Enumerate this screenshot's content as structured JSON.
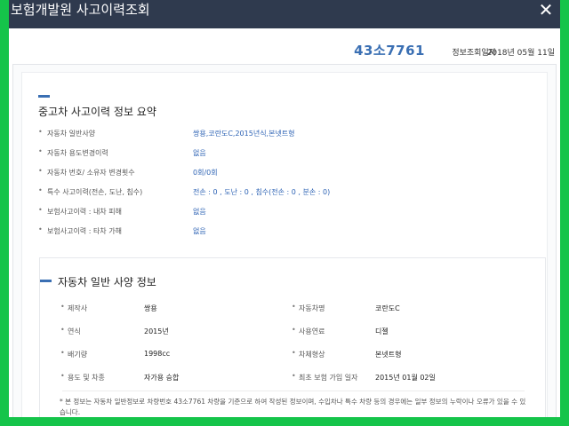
{
  "window": {
    "title": "보험개발원 사고이력조회",
    "close_icon": "close-icon"
  },
  "header": {
    "plate_number": "43소7761",
    "inquiry_label": "정보조회일자",
    "inquiry_date": "2018년 05월 11일"
  },
  "summary": {
    "title": "중고차 사고이력 정보 요약",
    "rows": [
      {
        "label": "자동차 일반사양",
        "value": "쌍용,코란도C,2015년식,본넷트형"
      },
      {
        "label": "자동차 용도변경이력",
        "value": "없음"
      },
      {
        "label": "자동차 번호/ 소유자 변경횟수",
        "value": "0회/0회"
      },
      {
        "label": "특수 사고이력(전손, 도난, 침수)",
        "value": "전손 : 0 , 도난 : 0 , 침수(전손 : 0 , 분손 : 0)"
      },
      {
        "label": "보험사고이력 : 내차 피해",
        "value": "없음"
      },
      {
        "label": "보험사고이력 : 타차 가해",
        "value": "없음"
      }
    ]
  },
  "specs": {
    "title": "자동차 일반 사양 정보",
    "left": [
      {
        "label": "제작사",
        "value": "쌍용"
      },
      {
        "label": "연식",
        "value": "2015년"
      },
      {
        "label": "배기량",
        "value": "1998cc"
      },
      {
        "label": "용도 및 차종",
        "value": "자가용 승합"
      }
    ],
    "right": [
      {
        "label": "자동차명",
        "value": "코란도C"
      },
      {
        "label": "사용연료",
        "value": "디젤"
      },
      {
        "label": "차체형상",
        "value": "본넷트형"
      },
      {
        "label": "최초 보험 가입 일자",
        "value": "2015년 01월 02일"
      }
    ],
    "note": "* 본 정보는 자동차 일반정보로 차량번호 43소7761 차량을 기준으로 하여 작성된 정보이며, 수입차나 특수 차량 등의 경우에는 일부 정보의 누락이나 오류가 있을 수 있습니다."
  },
  "colors": {
    "frame_border": "#15c44a",
    "title_bar": "#2f3a4e",
    "accent_blue": "#3a6fb3",
    "value_blue": "#2f64b5"
  }
}
